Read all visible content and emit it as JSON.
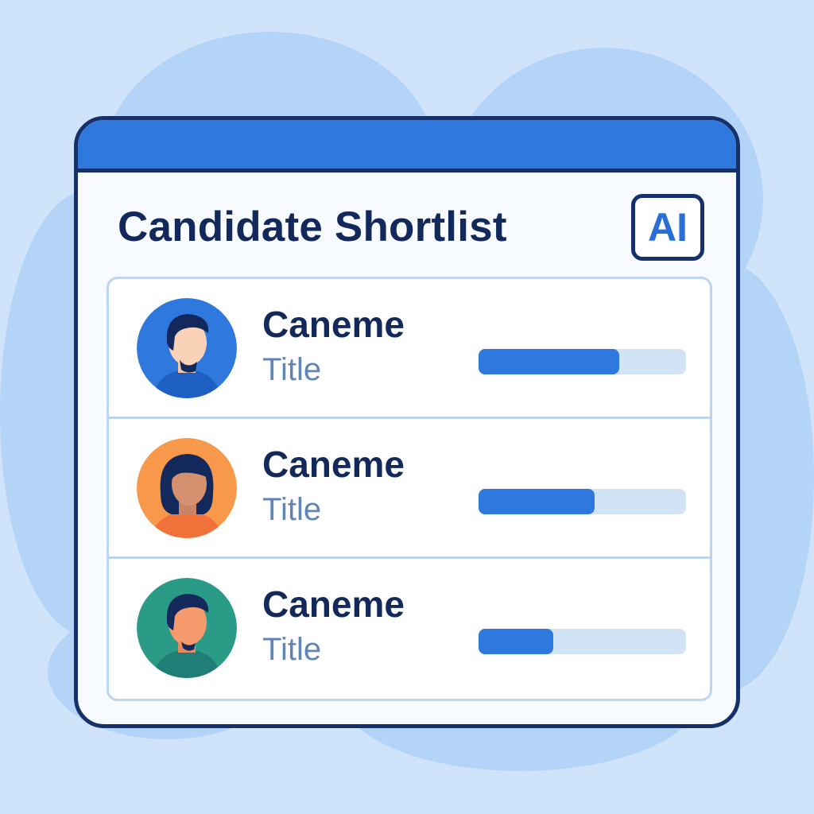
{
  "app": {
    "title": "Candidate Shortlist",
    "ai_badge": "AI"
  },
  "colors": {
    "accent": "#2f78de",
    "outline": "#16306b",
    "background": "#cfe4fb"
  },
  "candidates": [
    {
      "name": "Caneme",
      "title": "Title",
      "score": 0.68,
      "avatar": "man-avatar-blue"
    },
    {
      "name": "Caneme",
      "title": "Title",
      "score": 0.56,
      "avatar": "woman-avatar-orange"
    },
    {
      "name": "Caneme",
      "title": "Title",
      "score": 0.36,
      "avatar": "man-avatar-green"
    }
  ]
}
